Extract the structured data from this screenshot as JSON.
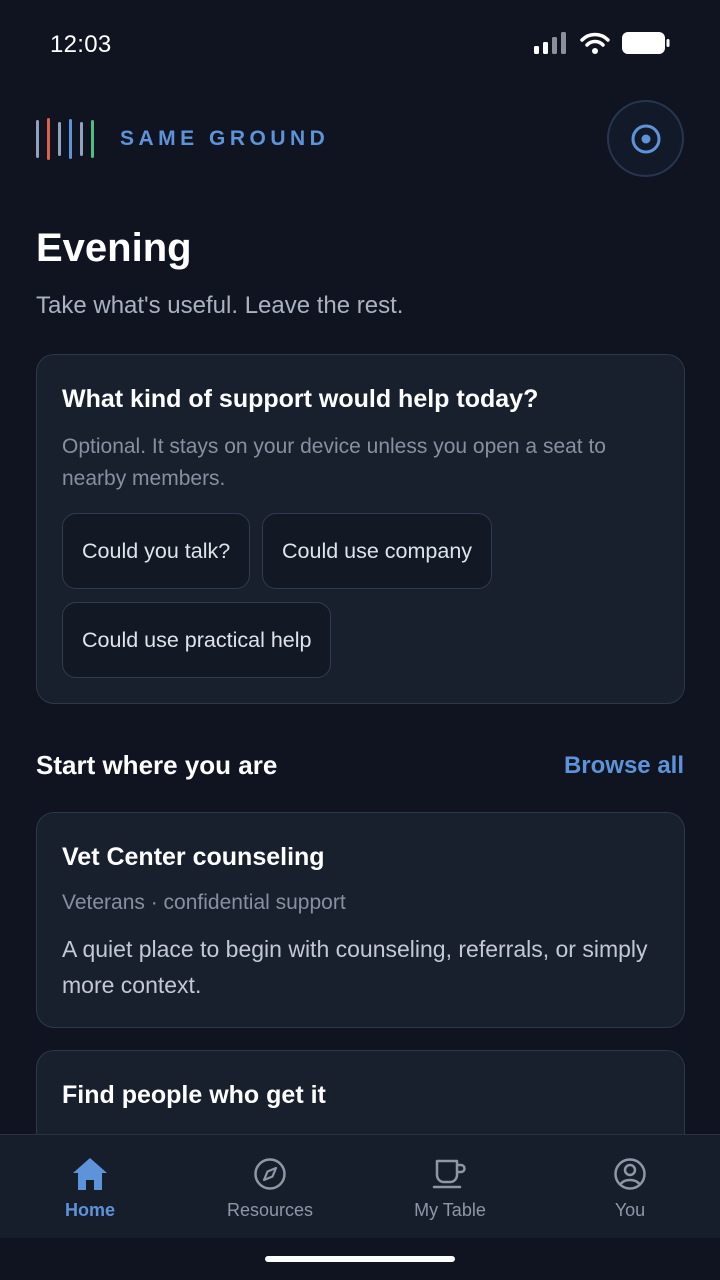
{
  "status_bar": {
    "time": "12:03"
  },
  "header": {
    "brand_name": "SAME GROUND",
    "logo_colors": [
      "#8fa3bf",
      "#e0614a",
      "#8fa3bf",
      "#5d93d9",
      "#8fa3bf",
      "#4fbf7f"
    ],
    "profile_icon": "target-icon"
  },
  "greeting": {
    "title": "Evening",
    "subtitle": "Take what's useful. Leave the rest."
  },
  "support": {
    "title": "What kind of support would help today?",
    "description": "Optional. It stays on your device unless you open a seat to nearby members.",
    "options": [
      "Could you talk?",
      "Could use company",
      "Could use practical help"
    ]
  },
  "section": {
    "title": "Start where you are",
    "action": "Browse all"
  },
  "resources": [
    {
      "title": "Vet Center counseling",
      "meta": "Veterans · confidential support",
      "description": "A quiet place to begin with counseling, referrals, or simply more context."
    },
    {
      "title": "Find people who get it"
    }
  ],
  "nav": {
    "items": [
      {
        "label": "Home",
        "icon": "home-icon",
        "active": true
      },
      {
        "label": "Resources",
        "icon": "compass-icon",
        "active": false
      },
      {
        "label": "My Table",
        "icon": "cup-icon",
        "active": false
      },
      {
        "label": "You",
        "icon": "user-circle-icon",
        "active": false
      }
    ]
  },
  "colors": {
    "background": "#0f1420",
    "card": "#18202e",
    "accent": "#5d93d9",
    "muted_text": "#8690a1"
  }
}
